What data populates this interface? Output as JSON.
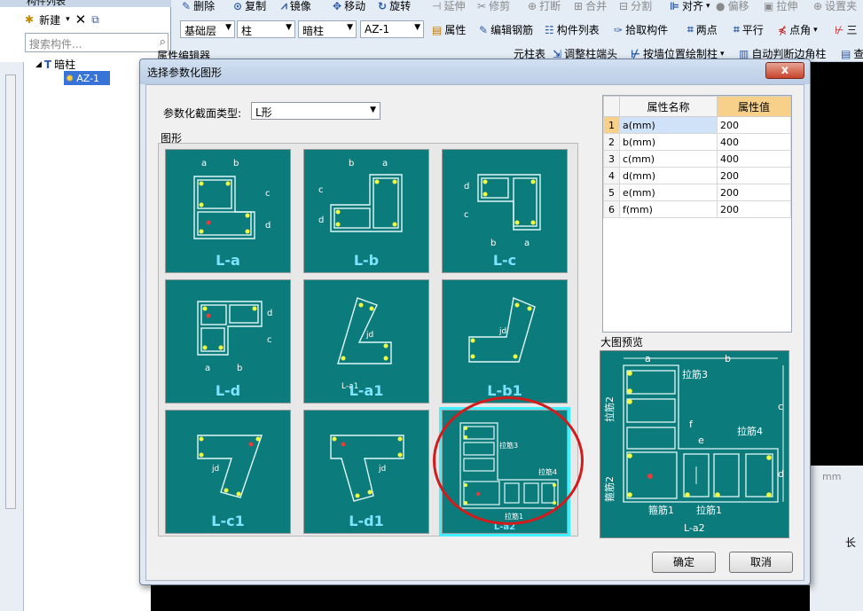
{
  "left_panel": {
    "title": "构件列表",
    "new_label": "新建",
    "search_placeholder": "搜索构件...",
    "tree_root": "暗柱",
    "tree_child": "AZ-1"
  },
  "toolbar": {
    "row1": [
      "删除",
      "复制",
      "镜像",
      "移动",
      "旋转",
      "延伸",
      "修剪",
      "打断",
      "合并",
      "分割",
      "对齐",
      "偏移",
      "拉伸",
      "设置夹"
    ],
    "row2_combos": [
      "基础层",
      "柱",
      "暗柱",
      "AZ-1"
    ],
    "row2_buttons": [
      "属性",
      "编辑钢筋",
      "构件列表",
      "拾取构件",
      "两点",
      "平行",
      "点角",
      "三"
    ],
    "row3": [
      "属性编辑器",
      "元柱表",
      "调整柱端头",
      "按墙位置绘制柱",
      "自动判断边角柱",
      "查"
    ]
  },
  "dialog": {
    "title": "选择参数化图形",
    "close_label": "x",
    "section_type_label": "参数化截面类型:",
    "section_type_value": "L形",
    "graphics_label": "图形",
    "tiles": [
      "L-a",
      "L-b",
      "L-c",
      "L-d",
      "L-a1",
      "L-b1",
      "L-c1",
      "L-d1",
      "L-a2"
    ],
    "selected_tile": "L-a2",
    "prop_headers": [
      "属性名称",
      "属性值"
    ],
    "props": [
      {
        "idx": "1",
        "name": "a(mm)",
        "value": "200"
      },
      {
        "idx": "2",
        "name": "b(mm)",
        "value": "400"
      },
      {
        "idx": "3",
        "name": "c(mm)",
        "value": "400"
      },
      {
        "idx": "4",
        "name": "d(mm)",
        "value": "200"
      },
      {
        "idx": "5",
        "name": "e(mm)",
        "value": "200"
      },
      {
        "idx": "6",
        "name": "f(mm)",
        "value": "200"
      }
    ],
    "preview_label": "大图预览",
    "preview_labels": {
      "a": "a",
      "b": "b",
      "c": "c",
      "d": "d",
      "e": "e",
      "f": "f",
      "tie3": "拉筋3",
      "tie2": "拉筋2",
      "tie4": "拉筋4",
      "stirrup2": "箍筋2",
      "stirrup1": "箍筋1",
      "tie1": "拉筋1",
      "name": "L-a2"
    },
    "ok_label": "确定",
    "cancel_label": "取消"
  },
  "right": {
    "unit": "mm",
    "col_label": "长"
  }
}
